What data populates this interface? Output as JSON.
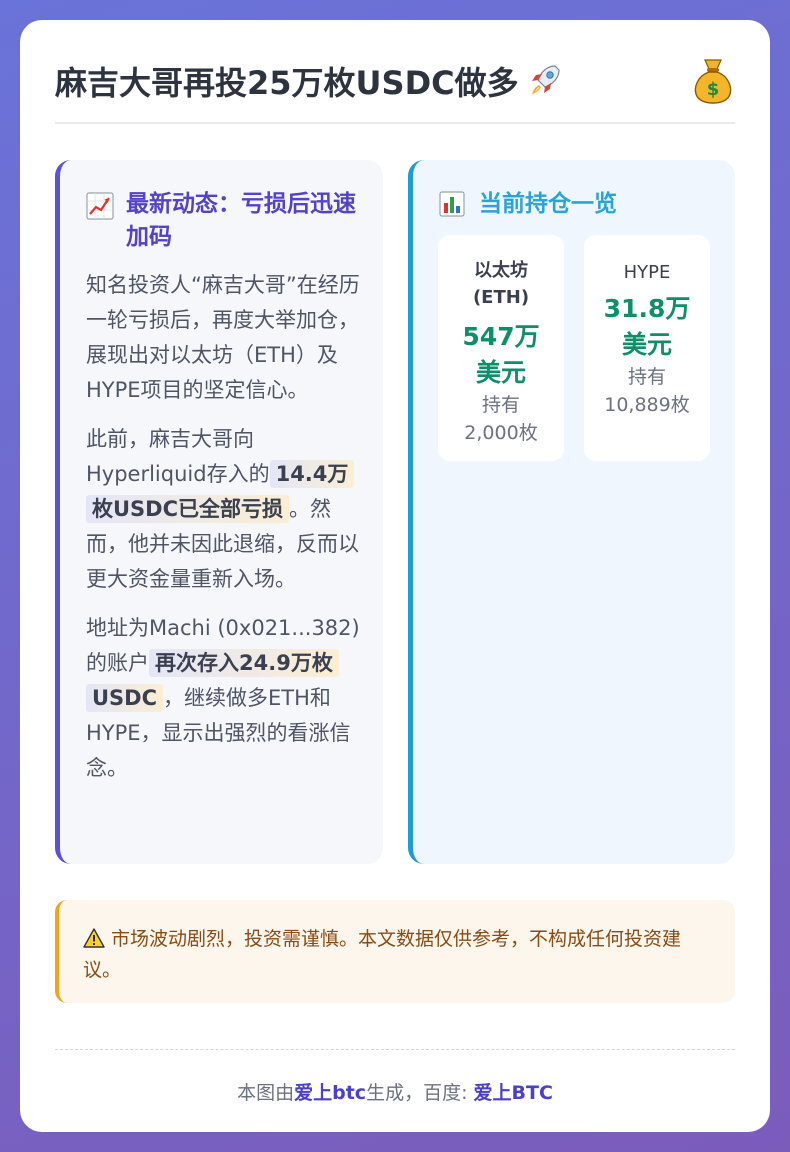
{
  "header": {
    "title": "麻吉大哥再投25万枚USDC做多",
    "title_icon": "rocket-icon",
    "corner_icon": "money-bag-icon"
  },
  "news": {
    "icon": "chart-increasing-icon",
    "title": "最新动态：亏损后迅速加码",
    "p1": "知名投资人“麻吉大哥”在经历一轮亏损后，再度大举加仓，展现出对以太坊（ETH）及HYPE项目的坚定信心。",
    "p2_before": "此前，麻吉大哥向Hyperliquid存入的",
    "p2_highlight": "14.4万枚USDC已全部亏损",
    "p2_after": "。然而，他并未因此退缩，反而以更大资金量重新入场。",
    "p3_before": "地址为Machi (0x021...382)的账户",
    "p3_highlight": "再次存入24.9万枚USDC",
    "p3_after": "，继续做多ETH和HYPE，显示出强烈的看涨信念。"
  },
  "holdings": {
    "icon": "bar-chart-icon",
    "title": "当前持仓一览",
    "items": [
      {
        "asset_line1": "以太坊",
        "asset_line2": "(ETH)",
        "value_line1": "547万",
        "value_line2": "美元",
        "held_line1": "持有",
        "held_line2": "2,000枚"
      },
      {
        "asset_line1": "HYPE",
        "value_line1": "31.8万",
        "value_line2": "美元",
        "held_line1": "持有",
        "held_line2": "10,889枚"
      }
    ]
  },
  "warning": {
    "icon": "warning-icon",
    "text": "市场波动剧烈，投资需谨慎。本文数据仅供参考，不构成任何投资建议。"
  },
  "footer": {
    "prefix": "本图由",
    "brand1": "爱上btc",
    "middle": "生成，百度: ",
    "brand2": "爱上BTC"
  },
  "colors": {
    "accent_purple": "#5b4fdc",
    "accent_blue": "#1f9bd9",
    "value_green": "#0d8f6a",
    "warning_orange": "#f2a31c"
  }
}
